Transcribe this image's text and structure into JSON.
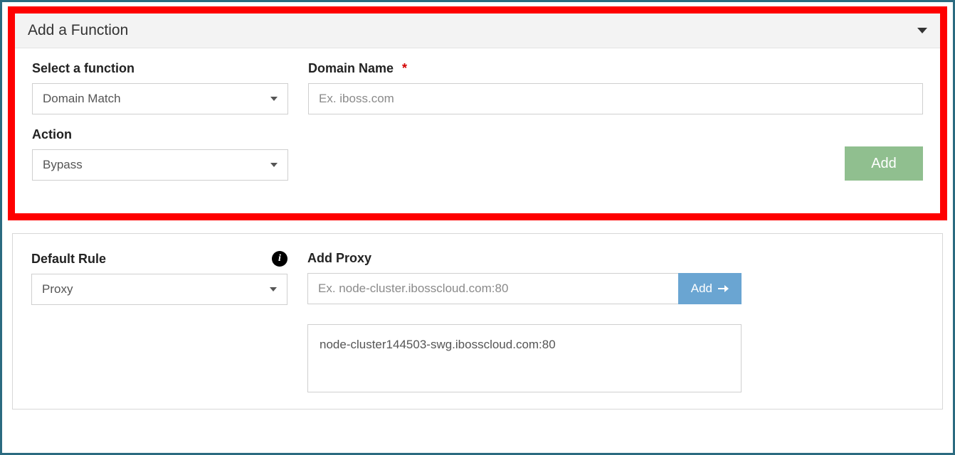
{
  "add_function": {
    "title": "Add a Function",
    "select_function": {
      "label": "Select a function",
      "value": "Domain Match"
    },
    "domain_name": {
      "label": "Domain Name",
      "required_marker": "*",
      "placeholder": "Ex. iboss.com",
      "value": ""
    },
    "action": {
      "label": "Action",
      "value": "Bypass"
    },
    "add_button": "Add"
  },
  "default_rule": {
    "label": "Default Rule",
    "value": "Proxy"
  },
  "add_proxy": {
    "label": "Add Proxy",
    "placeholder": "Ex. node-cluster.ibosscloud.com:80",
    "button": "Add",
    "entries": [
      "node-cluster144503-swg.ibosscloud.com:80"
    ]
  },
  "colors": {
    "highlight_border": "#fe0000",
    "outer_border": "#2b6b80",
    "primary_green": "#90bf8f",
    "primary_blue": "#6aa5d2"
  }
}
